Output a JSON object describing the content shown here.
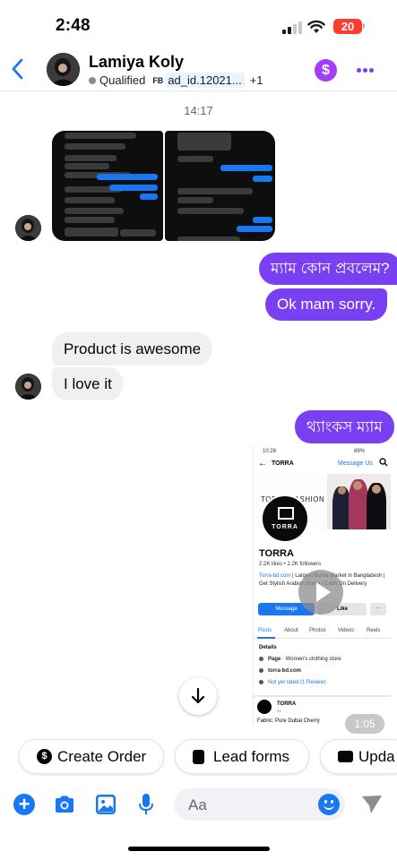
{
  "status": {
    "time": "2:48",
    "battery": "20"
  },
  "header": {
    "name": "Lamiya Koly",
    "qualified": "Qualified",
    "ad_tag": "FB",
    "ad_id": "ad_id.12021...",
    "extra": "+1",
    "dollar": "$"
  },
  "thread": {
    "timestamp": "14:17",
    "messages": [
      {
        "text": "ম্যাম কোন প্রবলেম?"
      },
      {
        "text": "Ok mam sorry."
      },
      {
        "text": "Product is awesome"
      },
      {
        "text": "I love it"
      },
      {
        "text": "থ্যাংকস ম্যাম"
      }
    ],
    "video_duration": "1:05"
  },
  "page_screenshot": {
    "time": "10:28",
    "status": "89%",
    "page_name": "TORRA",
    "message_us": "Message Us",
    "cover_text": "TORRA FASHION",
    "logo_word": "TORRA",
    "title": "TORRA",
    "likes": "2.2K likes • 2.2K followers",
    "desc_link": "Torra-bd.com",
    "desc_rest": " | Largest Burka Market in Bangladesh | Get Stylish Arabian Burka | Cash On Delivery",
    "btn_message": "Message",
    "btn_like": "Like",
    "btn_more": "···",
    "tabs": [
      "Posts",
      "About",
      "Photos",
      "Videos",
      "Reels"
    ],
    "details_title": "Details",
    "details": [
      {
        "bold": "Page",
        "text": " · Women's clothing store"
      },
      {
        "bold": "",
        "text": "torra-bd.com"
      },
      {
        "bold": "",
        "text": "Not yet rated (1 Review)"
      }
    ],
    "post_name": "TORRA",
    "post_sub": "2d",
    "post_text": "Fabric: Pure Dubai Cherry"
  },
  "quick_actions": [
    {
      "label": "Create Order",
      "icon": "dollar-icon"
    },
    {
      "label": "Lead forms",
      "icon": "form-icon"
    },
    {
      "label": "Upda",
      "icon": "card-icon"
    }
  ],
  "composer": {
    "placeholder": "Aa"
  }
}
